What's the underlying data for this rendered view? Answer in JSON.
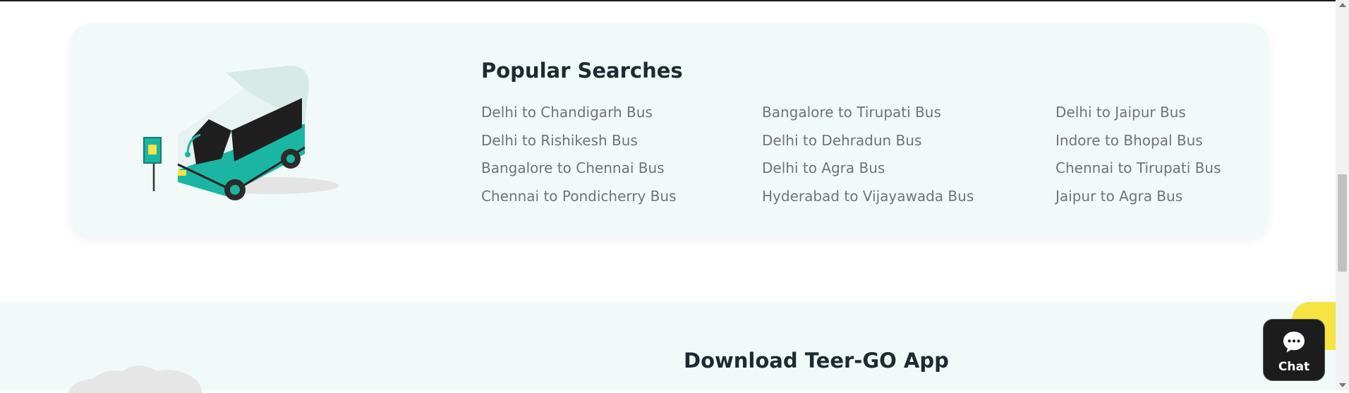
{
  "popular_searches": {
    "title": "Popular Searches",
    "routes": [
      "Delhi to Chandigarh Bus",
      "Bangalore to Tirupati Bus",
      "Delhi to Jaipur Bus",
      "Delhi to Rishikesh Bus",
      "Delhi to Dehradun Bus",
      "Indore to Bhopal Bus",
      "Bangalore to Chennai Bus",
      "Delhi to Agra Bus",
      "Chennai to Tirupati Bus",
      "Chennai to Pondicherry Bus",
      "Hyderabad to Vijayawada Bus",
      "Jaipur to Agra Bus"
    ]
  },
  "download_app": {
    "title": "Download Teer-GO App"
  },
  "chat_widget": {
    "label": "Chat",
    "icon": "chat-bubble-icon"
  },
  "colors": {
    "card_background": "#f1faf9",
    "bus_teal": "#1bb5a3",
    "heading": "#1e2a30",
    "link": "#737373",
    "chat_background": "#1c1c1c",
    "accent_yellow": "#f5e442"
  }
}
